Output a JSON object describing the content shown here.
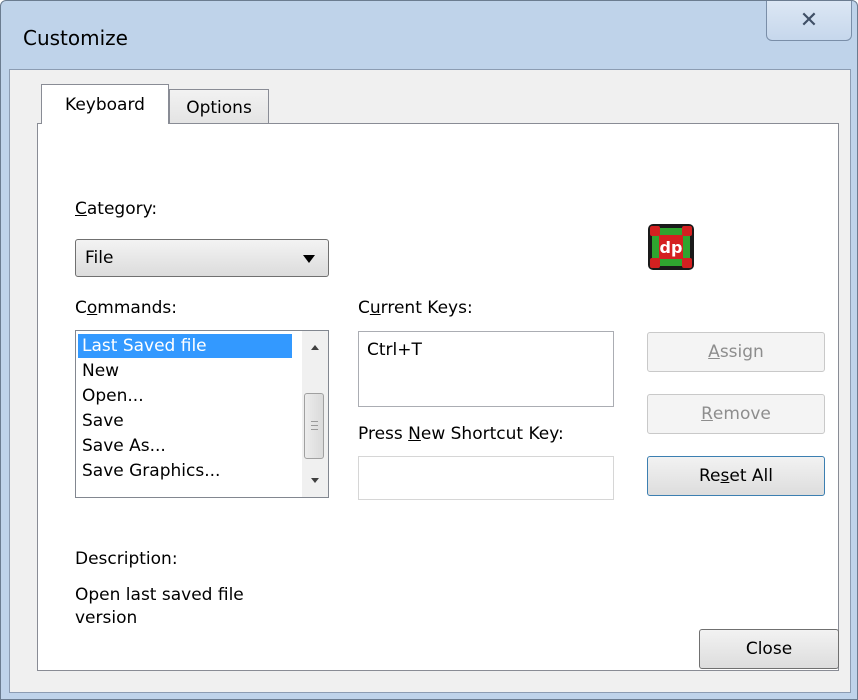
{
  "window": {
    "title": "Customize",
    "close_glyph": "✕"
  },
  "tabs": [
    {
      "label": "Keyboard",
      "active": true
    },
    {
      "label": "Options",
      "active": false
    }
  ],
  "category": {
    "label_mnemonic": "C",
    "label_rest": "ategory:",
    "value": "File"
  },
  "commands": {
    "label_first": "C",
    "label_mnemonic": "o",
    "label_rest": "mmands:",
    "items": [
      "Last Saved file",
      "New",
      "Open...",
      "Save",
      "Save As...",
      "Save Graphics..."
    ],
    "selected_index": 0
  },
  "current_keys": {
    "label_first": "C",
    "label_mnemonic": "u",
    "label_rest": "rrent Keys:",
    "value": "Ctrl+T"
  },
  "new_shortcut": {
    "label_before": "Press ",
    "label_mnemonic": "N",
    "label_rest": "ew Shortcut Key:",
    "value": ""
  },
  "buttons": {
    "assign": {
      "mnemonic": "A",
      "rest": "ssign",
      "enabled": false
    },
    "remove": {
      "mnemonic": "R",
      "rest": "emove",
      "enabled": false
    },
    "reset_all": {
      "before": "Re",
      "mnemonic": "s",
      "rest": "et All",
      "enabled": true
    },
    "close": {
      "label": "Close"
    }
  },
  "description": {
    "label": "Description:",
    "text_line1": "Open last saved file",
    "text_line2": "version"
  },
  "logo": {
    "text": "dp",
    "icon": "dp-app-logo-icon"
  },
  "colors": {
    "selection": "#3399ff",
    "window_frame": "#bfd3ea"
  }
}
